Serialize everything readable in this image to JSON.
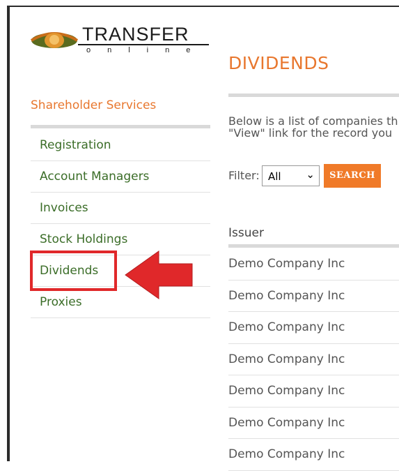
{
  "logo": {
    "word": "TRANSFER",
    "sub": "online"
  },
  "sidebar": {
    "heading": "Shareholder Services",
    "items": [
      {
        "label": "Registration"
      },
      {
        "label": "Account Managers"
      },
      {
        "label": "Invoices"
      },
      {
        "label": "Stock Holdings"
      },
      {
        "label": "Dividends"
      },
      {
        "label": "Proxies"
      }
    ]
  },
  "main": {
    "title": "DIVIDENDS",
    "description_line1": "Below is a list of companies th",
    "description_line2": "\"View\" link for the record you",
    "filter": {
      "label": "Filter:",
      "value": "All"
    },
    "search_button": "SEARCH",
    "table": {
      "header": "Issuer",
      "rows": [
        "Demo Company Inc",
        "Demo Company Inc",
        "Demo Company Inc",
        "Demo Company Inc",
        "Demo Company Inc",
        "Demo Company Inc",
        "Demo Company Inc"
      ]
    }
  },
  "colors": {
    "accent": "#e8772e",
    "link": "#3b6d28",
    "highlight": "#e0282a",
    "button": "#f07a28"
  }
}
